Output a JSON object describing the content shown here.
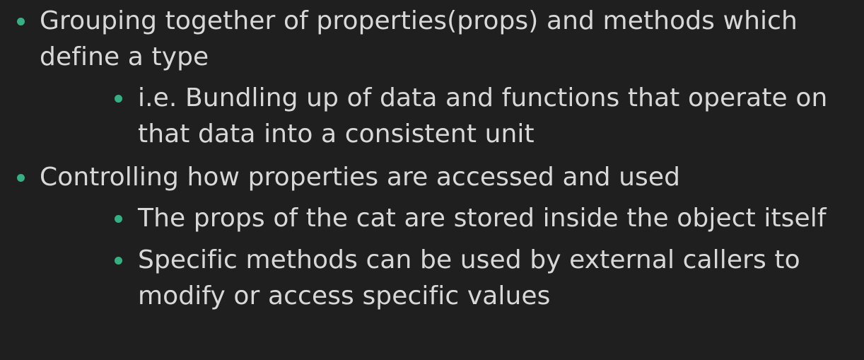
{
  "colors": {
    "background": "#1f1f1f",
    "text": "#d8d8d8",
    "bullet": "#35b083"
  },
  "bullets": [
    {
      "lines": [
        "Grouping together of properties(props) and methods which",
        "define a type"
      ],
      "children": [
        {
          "lines": [
            "i.e. Bundling up of data and functions that operate on",
            "that data into a consistent unit"
          ]
        }
      ]
    },
    {
      "lines": [
        "Controlling how properties are accessed and used"
      ],
      "children": [
        {
          "lines": [
            "The props of the cat are stored inside the object itself"
          ]
        },
        {
          "lines": [
            "Specific methods can be used by external callers to",
            "modify or access specific values"
          ]
        }
      ]
    }
  ]
}
